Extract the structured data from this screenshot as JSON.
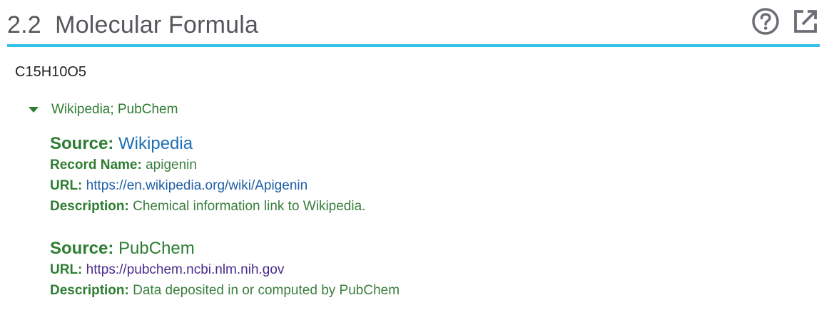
{
  "section": {
    "number": "2.2",
    "title": "Molecular Formula",
    "help_icon": "help-circle-icon",
    "popout_icon": "external-link-icon",
    "accent_color": "#2fc1e6"
  },
  "formula": "C15H10O5",
  "references": {
    "toggle_label": "Wikipedia; PubChem",
    "sources": [
      {
        "label": "Source:",
        "name": "Wikipedia",
        "record_name_label": "Record Name:",
        "record_name": "apigenin",
        "url_label": "URL:",
        "url": "https://en.wikipedia.org/wiki/Apigenin",
        "description_label": "Description:",
        "description": "Chemical information link to Wikipedia."
      },
      {
        "label": "Source:",
        "name": "PubChem",
        "url_label": "URL:",
        "url": "https://pubchem.ncbi.nlm.nih.gov",
        "description_label": "Description:",
        "description": "Data deposited in or computed by PubChem"
      }
    ]
  }
}
